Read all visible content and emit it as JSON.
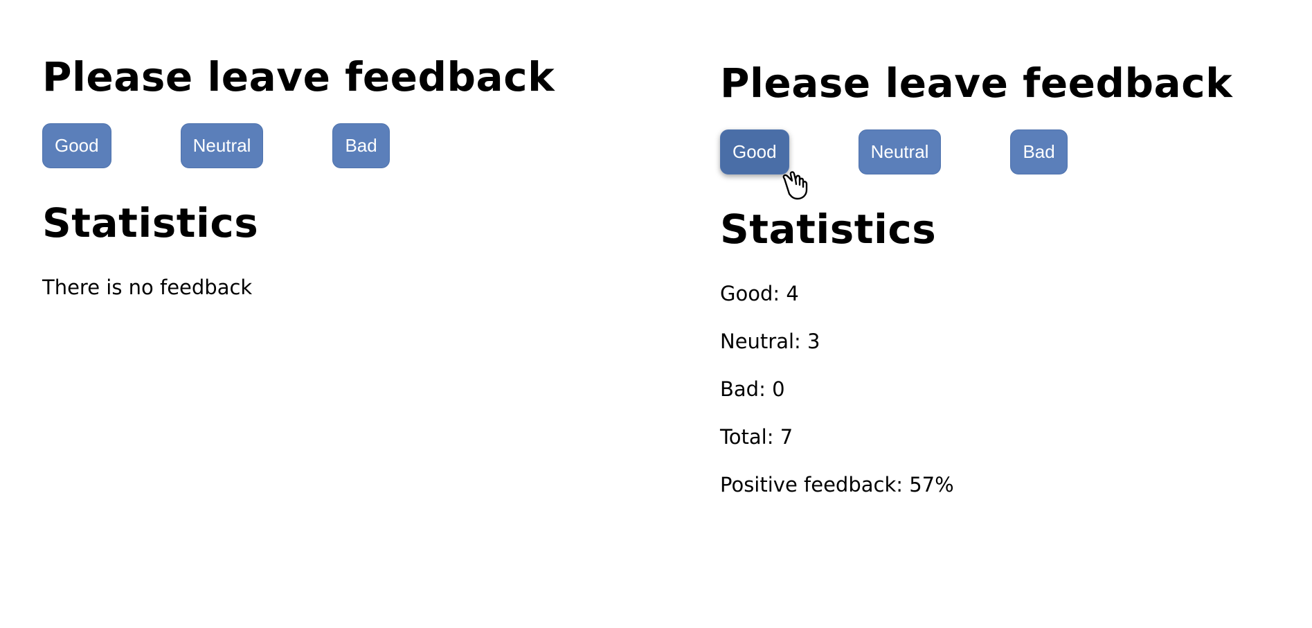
{
  "left_panel": {
    "title": "Please leave feedback",
    "buttons": {
      "good": "Good",
      "neutral": "Neutral",
      "bad": "Bad"
    },
    "statistics_title": "Statistics",
    "empty_message": "There is no feedback"
  },
  "right_panel": {
    "title": "Please leave feedback",
    "buttons": {
      "good": "Good",
      "neutral": "Neutral",
      "bad": "Bad"
    },
    "statistics_title": "Statistics",
    "stats": {
      "good": "Good: 4",
      "neutral": "Neutral: 3",
      "bad": "Bad: 0",
      "total": "Total: 7",
      "positive": "Positive feedback: 57%"
    }
  },
  "colors": {
    "button_bg": "#5b7fba",
    "button_hover_bg": "#4a6ea7",
    "button_text": "#ffffff",
    "text": "#000000",
    "background": "#ffffff"
  },
  "icons": {
    "cursor": "hand-pointer-icon"
  }
}
